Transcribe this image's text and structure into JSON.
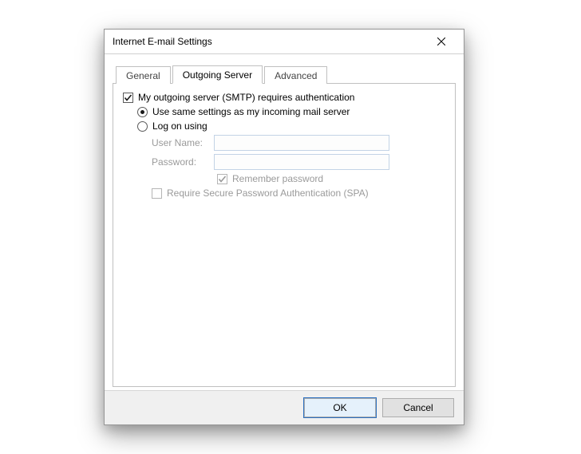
{
  "window": {
    "title": "Internet E-mail Settings"
  },
  "tabs": {
    "general": "General",
    "outgoing": "Outgoing Server",
    "advanced": "Advanced"
  },
  "outgoing_server": {
    "requires_auth_label": "My outgoing server (SMTP) requires authentication",
    "use_same_label": "Use same settings as my incoming mail server",
    "log_on_label": "Log on using",
    "user_name_label": "User Name:",
    "user_name_value": "",
    "password_label": "Password:",
    "password_value": "",
    "remember_pw_label": "Remember password",
    "require_spa_label": "Require Secure Password Authentication (SPA)"
  },
  "buttons": {
    "ok": "OK",
    "cancel": "Cancel"
  }
}
